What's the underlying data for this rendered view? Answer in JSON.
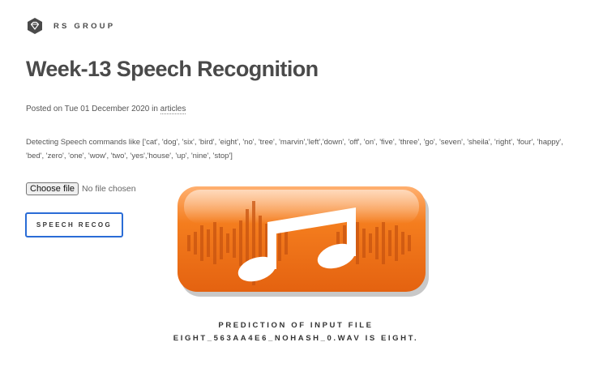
{
  "brand": {
    "name": "RS GROUP",
    "logo_icon": "diamond-hexagon-icon"
  },
  "post": {
    "title": "Week-13 Speech Recognition",
    "meta_prefix": "Posted on Tue 01 December 2020 in ",
    "meta_category": "articles",
    "description": "Detecting Speech commands like ['cat', 'dog', 'six', 'bird', 'eight', 'no', 'tree', 'marvin','left','down', 'off', 'on', 'five', 'three', 'go', 'seven', 'sheila', 'right', 'four', 'happy', 'bed', 'zero', 'one', 'wow', 'two', 'yes','house', 'up', 'nine', 'stop']"
  },
  "upload": {
    "button_label": "Choose file",
    "status": "No file chosen"
  },
  "actions": {
    "speech_button_label": "SPEECH RECOG"
  },
  "result": {
    "prediction_text": "PREDICTION OF INPUT FILE EIGHT_563AA4E6_NOHASH_0.WAV IS EIGHT."
  },
  "image": {
    "icon": "music-note-icon",
    "accent_color": "#f07818"
  },
  "colors": {
    "button_border": "#2a6cd6",
    "text": "#555555",
    "title": "#4a4a4a"
  }
}
